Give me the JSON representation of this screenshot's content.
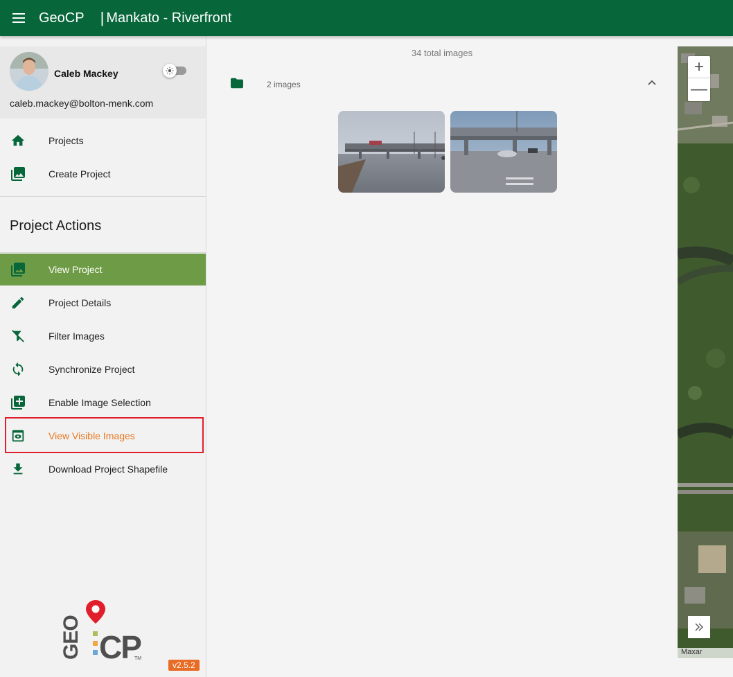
{
  "header": {
    "app_name": "GeoCP",
    "separator": "|",
    "project_title": "Mankato - Riverfront"
  },
  "user": {
    "name": "Caleb Mackey",
    "email": "caleb.mackey@bolton-menk.com"
  },
  "nav": {
    "main_items": [
      {
        "label": "Projects",
        "icon": "home-icon"
      },
      {
        "label": "Create Project",
        "icon": "photo-library-icon"
      }
    ],
    "section_title": "Project Actions",
    "action_items": [
      {
        "label": "View Project",
        "icon": "photo-library-icon",
        "active": true
      },
      {
        "label": "Project Details",
        "icon": "pencil-icon"
      },
      {
        "label": "Filter Images",
        "icon": "filter-off-icon"
      },
      {
        "label": "Synchronize Project",
        "icon": "sync-icon"
      },
      {
        "label": "Enable Image Selection",
        "icon": "add-box-icon"
      },
      {
        "label": "View Visible Images",
        "icon": "eye-box-icon",
        "highlighted": true
      },
      {
        "label": "Download Project Shapefile",
        "icon": "download-icon"
      }
    ]
  },
  "logo": {
    "letters": "GEO:CP",
    "tm": "TM"
  },
  "version": "v2.5.2",
  "main": {
    "total_images": "34 total images",
    "folder_count": "2 images"
  },
  "map": {
    "zoom_in": "+",
    "zoom_out": "—",
    "attribution": "Maxar"
  },
  "colors": {
    "primary": "#07663a",
    "active_nav": "#6e9b45",
    "highlight_text": "#e87722",
    "highlight_border": "#e11f2c",
    "version_badge": "#e86c25"
  }
}
